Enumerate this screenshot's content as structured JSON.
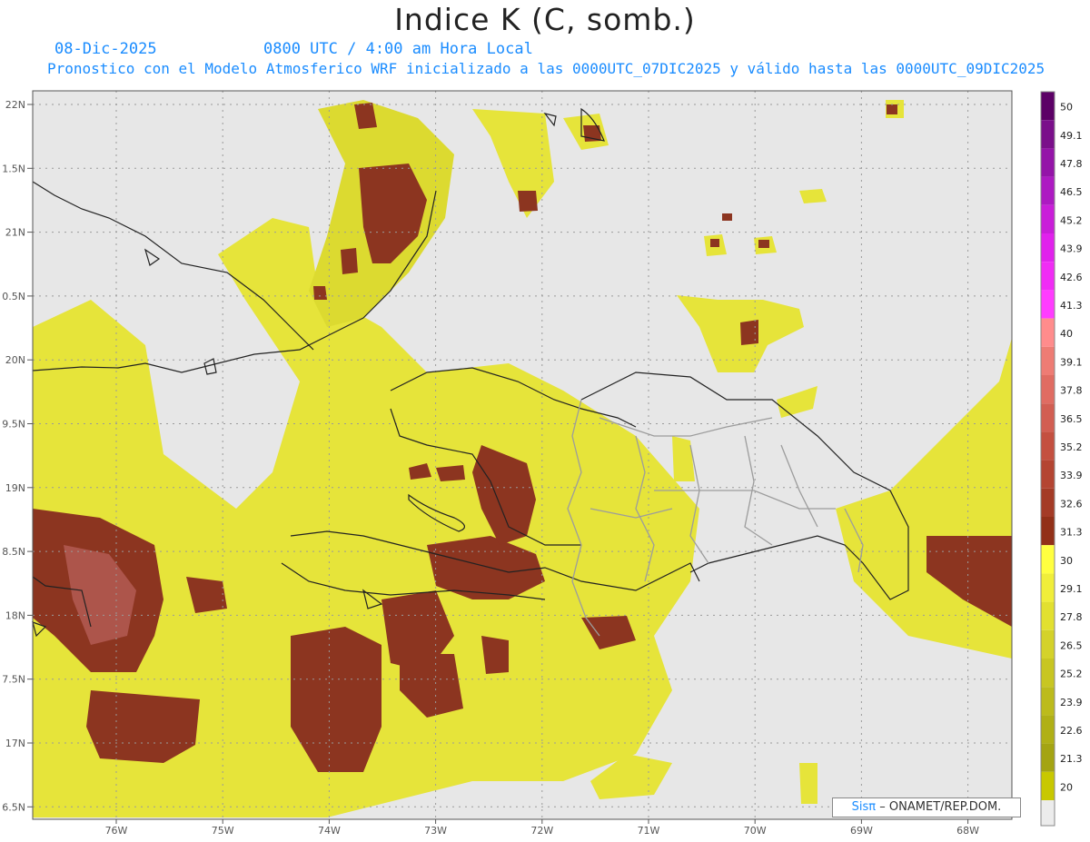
{
  "header": {
    "title": "Indice K (C, somb.)",
    "date": "08-Dic-2025",
    "time": "0800 UTC / 4:00 am Hora Local",
    "description": "Pronostico con el Modelo Atmosferico WRF inicializado a las 0000UTC_07DIC2025 y válido hasta las  0000UTC_09DIC2025"
  },
  "axes": {
    "lat_labels": [
      "22N",
      "1.5N",
      "21N",
      "0.5N",
      "20N",
      "9.5N",
      "19N",
      "8.5N",
      "18N",
      "7.5N",
      "17N",
      "6.5N"
    ],
    "lon_labels": [
      "76W",
      "75W",
      "74W",
      "73W",
      "72W",
      "71W",
      "70W",
      "69W",
      "68W"
    ]
  },
  "colorbar": {
    "labels": [
      "50",
      "49.1",
      "47.8",
      "46.5",
      "45.2",
      "43.9",
      "42.6",
      "41.3",
      "40",
      "39.1",
      "37.8",
      "36.5",
      "35.2",
      "33.9",
      "32.6",
      "31.3",
      "30",
      "29.1",
      "27.8",
      "26.5",
      "25.2",
      "23.9",
      "22.6",
      "21.3",
      "20"
    ],
    "colors": [
      "#5c0066",
      "#7a0f8a",
      "#9414a8",
      "#ad1ac2",
      "#c91ed9",
      "#e022ec",
      "#f02cf5",
      "#ff3cff",
      "#ff8c8c",
      "#ee7c74",
      "#e06c62",
      "#d25e52",
      "#c45040",
      "#b44532",
      "#a43b26",
      "#923018",
      "#ffff40",
      "#f0ee3a",
      "#e2e030",
      "#d4d22a",
      "#c8c622",
      "#bcbb1c",
      "#b0b016",
      "#a4a412",
      "#c8c800"
    ],
    "below_color": "#ececec"
  },
  "colors": {
    "no_data": "#e7e7e7",
    "low_k": "#e8e83a",
    "high_k": "#8c3520",
    "coastline": "#222222",
    "border": "#999999"
  },
  "credit": {
    "brand": "Sisπ",
    "text": "– ONAMET/REP.DOM."
  }
}
